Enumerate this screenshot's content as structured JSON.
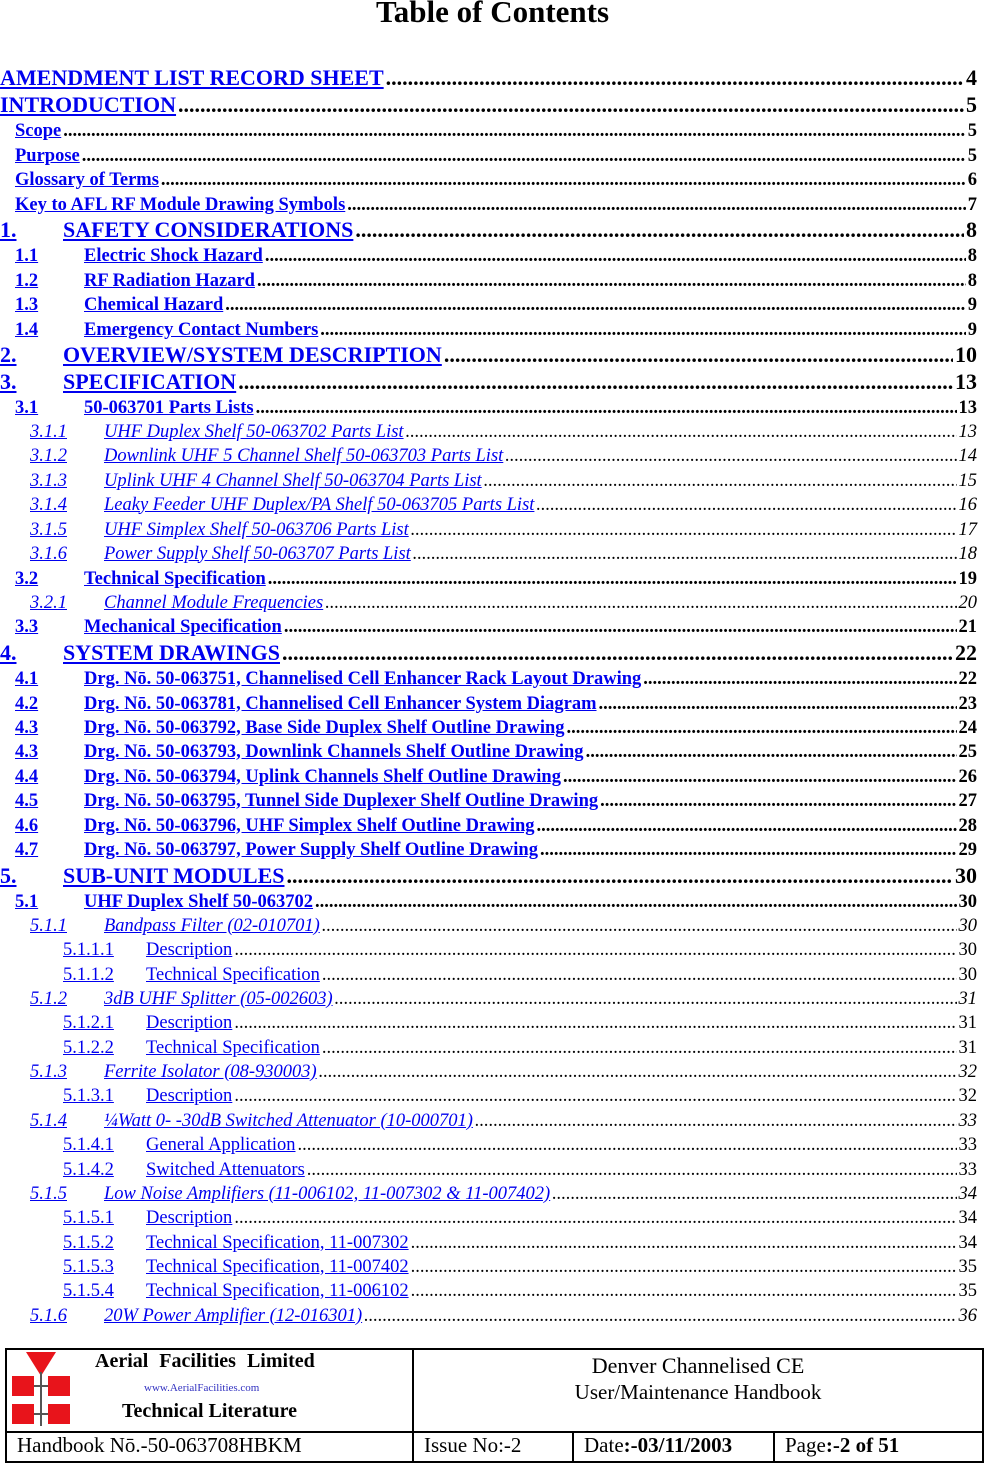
{
  "title": "Table of Contents",
  "entries": [
    {
      "level": 0,
      "num": "",
      "title": "AMENDMENT LIST RECORD SHEET",
      "page": "4"
    },
    {
      "level": 0,
      "num": "",
      "title": "INTRODUCTION",
      "page": "5"
    },
    {
      "level": 1,
      "num": "",
      "title": "Scope",
      "page": "5"
    },
    {
      "level": 1,
      "num": "",
      "title": "Purpose",
      "page": "5"
    },
    {
      "level": 1,
      "num": "",
      "title": "Glossary of Terms",
      "page": "6"
    },
    {
      "level": 1,
      "num": "",
      "title": "Key to AFL RF Module Drawing Symbols",
      "page": "7"
    },
    {
      "level": 0,
      "num": "1.",
      "title": "SAFETY CONSIDERATIONS",
      "page": "8"
    },
    {
      "level": 1,
      "num": "1.1",
      "title": "Electric Shock Hazard",
      "page": "8"
    },
    {
      "level": 1,
      "num": "1.2",
      "title": "RF Radiation Hazard",
      "page": "8"
    },
    {
      "level": 1,
      "num": "1.3",
      "title": "Chemical Hazard",
      "page": "9"
    },
    {
      "level": 1,
      "num": "1.4",
      "title": "Emergency Contact Numbers",
      "page": "9"
    },
    {
      "level": 0,
      "num": "2.",
      "title": "OVERVIEW/SYSTEM DESCRIPTION",
      "page": "10"
    },
    {
      "level": 0,
      "num": "3.",
      "title": "SPECIFICATION",
      "page": "13"
    },
    {
      "level": 1,
      "num": "3.1",
      "title": "50-063701 Parts Lists",
      "page": "13"
    },
    {
      "level": 2,
      "num": "3.1.1",
      "title": "UHF Duplex Shelf 50-063702 Parts List",
      "page": "13"
    },
    {
      "level": 2,
      "num": "3.1.2",
      "title": "Downlink UHF 5 Channel Shelf 50-063703 Parts List",
      "page": "14"
    },
    {
      "level": 2,
      "num": "3.1.3",
      "title": "Uplink UHF 4 Channel Shelf 50-063704 Parts List",
      "page": "15"
    },
    {
      "level": 2,
      "num": "3.1.4",
      "title": "Leaky Feeder UHF Duplex/PA Shelf 50-063705 Parts List",
      "page": "16"
    },
    {
      "level": 2,
      "num": "3.1.5",
      "title": "UHF Simplex Shelf 50-063706 Parts List",
      "page": "17"
    },
    {
      "level": 2,
      "num": "3.1.6",
      "title": "Power Supply Shelf 50-063707 Parts List",
      "page": "18"
    },
    {
      "level": 1,
      "num": "3.2",
      "title": "Technical Specification",
      "page": "19"
    },
    {
      "level": 2,
      "num": "3.2.1",
      "title": "Channel Module Frequencies",
      "page": "20"
    },
    {
      "level": 1,
      "num": "3.3",
      "title": "Mechanical Specification",
      "page": "21"
    },
    {
      "level": 0,
      "num": "4.",
      "title": "SYSTEM DRAWINGS",
      "page": "22"
    },
    {
      "level": 1,
      "num": "4.1",
      "title": "Drg. Nō. 50-063751, Channelised Cell Enhancer Rack Layout Drawing",
      "page": "22"
    },
    {
      "level": 1,
      "num": "4.2",
      "title": "Drg. Nō. 50-063781, Channelised Cell Enhancer System Diagram",
      "page": "23"
    },
    {
      "level": 1,
      "num": "4.3",
      "title": "Drg. Nō. 50-063792, Base Side Duplex Shelf Outline Drawing",
      "page": "24"
    },
    {
      "level": 1,
      "num": "4.3",
      "title": "Drg. Nō. 50-063793, Downlink Channels Shelf Outline Drawing",
      "page": "25"
    },
    {
      "level": 1,
      "num": "4.4",
      "title": "Drg. Nō. 50-063794, Uplink Channels Shelf Outline Drawing",
      "page": "26"
    },
    {
      "level": 1,
      "num": "4.5",
      "title": "Drg. Nō. 50-063795, Tunnel Side Duplexer Shelf Outline Drawing",
      "page": "27"
    },
    {
      "level": 1,
      "num": "4.6",
      "title": "Drg. Nō. 50-063796, UHF Simplex Shelf Outline Drawing",
      "page": "28"
    },
    {
      "level": 1,
      "num": "4.7",
      "title": "Drg. Nō. 50-063797, Power Supply Shelf Outline Drawing",
      "page": "29"
    },
    {
      "level": 0,
      "num": "5.",
      "title": "SUB-UNIT MODULES",
      "page": "30"
    },
    {
      "level": 1,
      "num": "5.1",
      "title": "UHF Duplex Shelf 50-063702",
      "page": "30"
    },
    {
      "level": 2,
      "num": "5.1.1",
      "title": "Bandpass Filter (02-010701)",
      "page": "30"
    },
    {
      "level": 3,
      "num": "5.1.1.1",
      "title": "Description",
      "page": "30"
    },
    {
      "level": 3,
      "num": "5.1.1.2",
      "title": "Technical Specification",
      "page": "30"
    },
    {
      "level": 2,
      "num": "5.1.2",
      "title": "3dB UHF Splitter (05-002603)",
      "page": "31"
    },
    {
      "level": 3,
      "num": "5.1.2.1",
      "title": "Description",
      "page": "31"
    },
    {
      "level": 3,
      "num": "5.1.2.2",
      "title": "Technical Specification",
      "page": "31"
    },
    {
      "level": 2,
      "num": "5.1.3",
      "title": "Ferrite Isolator (08-930003)",
      "page": "32"
    },
    {
      "level": 3,
      "num": "5.1.3.1",
      "title": "Description",
      "page": "32"
    },
    {
      "level": 2,
      "num": "5.1.4",
      "title": "¼Watt 0- -30dB Switched Attenuator (10-000701)",
      "page": "33"
    },
    {
      "level": 3,
      "num": "5.1.4.1",
      "title": " General Application",
      "page": "33"
    },
    {
      "level": 3,
      "num": "5.1.4.2",
      "title": "Switched Attenuators",
      "page": "33"
    },
    {
      "level": 2,
      "num": "5.1.5",
      "title": "Low Noise Amplifiers (11-006102, 11-007302 & 11-007402)",
      "page": "34"
    },
    {
      "level": 3,
      "num": "5.1.5.1",
      "title": "Description",
      "page": "34"
    },
    {
      "level": 3,
      "num": "5.1.5.2",
      "title": "Technical Specification, 11-007302",
      "page": "34"
    },
    {
      "level": 3,
      "num": "5.1.5.3",
      "title": "Technical Specification, 11-007402",
      "page": "35"
    },
    {
      "level": 3,
      "num": "5.1.5.4",
      "title": "Technical Specification, 11-006102",
      "page": "35"
    },
    {
      "level": 2,
      "num": "5.1.6",
      "title": "20W Power Amplifier (12-016301)",
      "page": "36"
    }
  ],
  "footer": {
    "company": "Aerial Facilities Limited",
    "website": "www.AerialFacilities.com",
    "tagline": "Technical Literature",
    "doc_title": "Denver Channelised CE",
    "doc_subtitle": "User/Maintenance Handbook",
    "handbook": "Handbook Nō.-50-063708HBKM",
    "issue": "Issue No:-2",
    "date_label": "Date",
    "date_value": ":-03/11/2003",
    "page_label": "Page",
    "page_value": ":-2 of 51",
    "logo_color": "#e8141b"
  }
}
